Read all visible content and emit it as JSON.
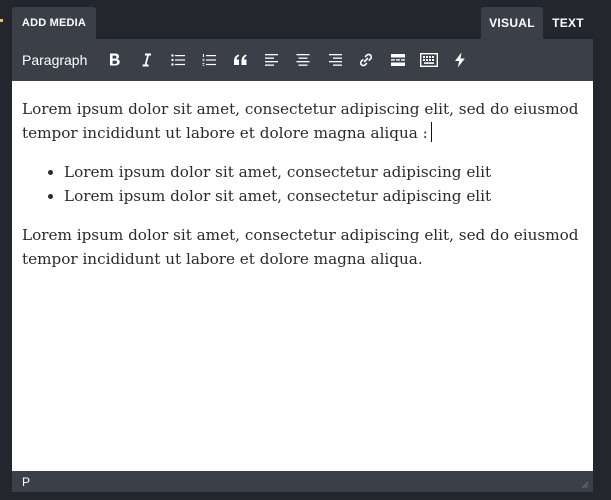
{
  "header": {
    "add_media_label": "ADD MEDIA",
    "tabs": [
      {
        "label": "VISUAL",
        "active": true
      },
      {
        "label": "TEXT",
        "active": false
      }
    ]
  },
  "toolbar": {
    "format_value": "Paragraph",
    "buttons": [
      "bold-icon",
      "italic-icon",
      "bullet-list-icon",
      "numbered-list-icon",
      "blockquote-icon",
      "align-left-icon",
      "align-center-icon",
      "align-right-icon",
      "link-icon",
      "read-more-icon",
      "toolbar-toggle-icon",
      "bolt-icon"
    ]
  },
  "editor": {
    "paragraph1": "Lorem ipsum dolor sit amet, consectetur adipiscing elit, sed do eiusmod tempor incididunt ut labore et dolore magna aliqua :",
    "list_items": [
      "Lorem ipsum dolor sit amet, consectetur adipiscing elit",
      "Lorem ipsum dolor sit amet, consectetur adipiscing elit"
    ],
    "paragraph2": "Lorem ipsum dolor sit amet, consectetur adipiscing elit, sed do eiusmod tempor incididunt ut labore et dolore magna aliqua."
  },
  "statusbar": {
    "path": "P"
  },
  "colors": {
    "page_background": "#23272d",
    "panel": "#3b4048",
    "accent": "#f0c33c",
    "editor_background": "#ffffff",
    "text": "#2a2a2a"
  }
}
